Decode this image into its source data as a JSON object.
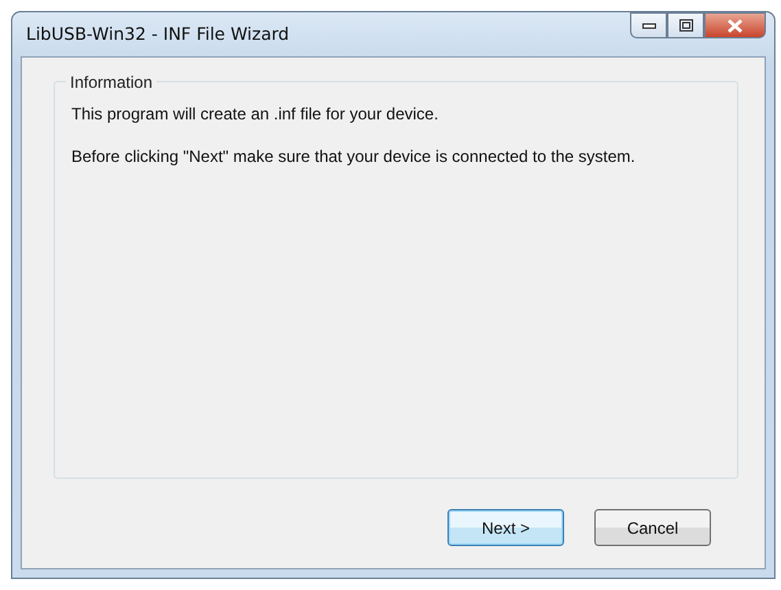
{
  "window": {
    "title": "LibUSB-Win32 - INF File Wizard"
  },
  "group": {
    "title": "Information",
    "paragraphs": [
      "This program will create an .inf file for your device.",
      "Before clicking \"Next\" make sure that your device is connected to the system."
    ]
  },
  "buttons": [
    {
      "label": "Next >",
      "default": true
    },
    {
      "label": "Cancel",
      "default": false
    }
  ]
}
